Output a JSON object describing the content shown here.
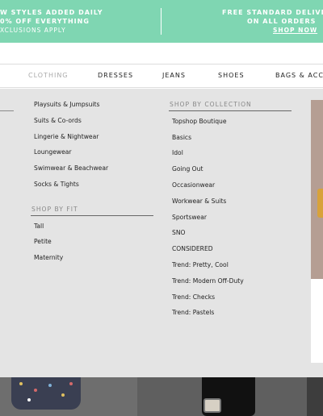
{
  "promo": {
    "left_line1": "W STYLES ADDED DAILY",
    "left_line2": "0% OFF EVERYTHING",
    "left_line3": "XCLUSIONS APPLY",
    "right_line1": "FREE STANDARD DELIVER",
    "right_line2": "ON ALL ORDERS",
    "right_link": "SHOP NOW"
  },
  "nav": {
    "items": [
      "CLOTHING",
      "DRESSES",
      "JEANS",
      "SHOES",
      "BAGS & ACCES"
    ],
    "active": "CLOTHING"
  },
  "menu": {
    "col1_links": [
      "Playsuits & Jumpsuits",
      "Suits & Co-ords",
      "Lingerie & Nightwear",
      "Loungewear",
      "Swimwear & Beachwear",
      "Socks & Tights"
    ],
    "fit_heading": "SHOP BY FIT",
    "fit_links": [
      "Tall",
      "Petite",
      "Maternity"
    ],
    "collection_heading": "SHOP BY COLLECTION",
    "collection_links": [
      "Topshop Boutique",
      "Basics",
      "Idol",
      "Going Out",
      "Occasionwear",
      "Workwear & Suits",
      "Sportswear",
      "SNO",
      "CONSIDERED",
      "Trend: Pretty, Cool",
      "Trend: Modern Off-Duty",
      "Trend: Checks",
      "Trend: Pastels"
    ]
  },
  "colors": {
    "promo_bg": "#7fd6b2",
    "menu_bg": "#e4e4e4",
    "text": "#222222",
    "muted": "#888888"
  }
}
